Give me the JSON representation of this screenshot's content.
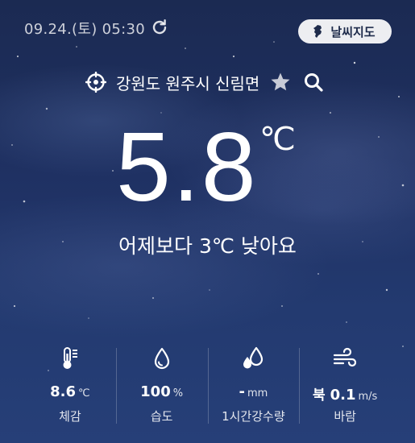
{
  "header": {
    "datetime": "09.24.(토) 05:30",
    "map_button_label": "날씨지도"
  },
  "location": {
    "name": "강원도 원주시 신림면"
  },
  "current": {
    "temperature": "5.8",
    "unit": "℃",
    "comparison": "어제보다 3℃ 낮아요"
  },
  "stats": [
    {
      "icon": "thermometer-icon",
      "value": "8.6",
      "unit": "℃",
      "label": "체감"
    },
    {
      "icon": "humidity-drop-icon",
      "value": "100",
      "unit": "%",
      "label": "습도"
    },
    {
      "icon": "rain-drops-icon",
      "value": "-",
      "unit": "mm",
      "label": "1시간강수량"
    },
    {
      "icon": "wind-icon",
      "direction": "북",
      "value": "0.1",
      "unit": "m/s",
      "label": "바람"
    }
  ],
  "colors": {
    "sky_top": "#1b2a52",
    "sky_bottom": "#263f78",
    "map_button_bg": "#eef0f5",
    "map_button_text": "#1d2a4a",
    "favorite_star": "#c8cbd6"
  }
}
